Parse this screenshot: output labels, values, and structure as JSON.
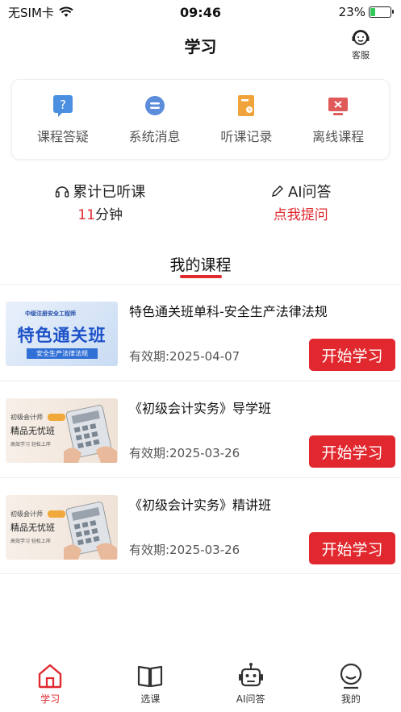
{
  "status_bar": {
    "carrier": "无SIM卡",
    "time": "09:46",
    "battery": "23%",
    "battery_level": 0.23
  },
  "header": {
    "title": "学习",
    "service_label": "客服"
  },
  "quick_actions": [
    {
      "label": "课程答疑",
      "icon": "question-icon",
      "color": "#4a8fe0"
    },
    {
      "label": "系统消息",
      "icon": "message-icon",
      "color": "#5b8ddb"
    },
    {
      "label": "听课记录",
      "icon": "record-icon",
      "color": "#f0a33a"
    },
    {
      "label": "离线课程",
      "icon": "offline-icon",
      "color": "#e05a5a"
    }
  ],
  "stats": {
    "listen_title": "累计已听课",
    "listen_value": "11",
    "listen_unit": "分钟",
    "ai_title": "AI问答",
    "ai_action": "点我提问"
  },
  "section_title": "我的课程",
  "courses": [
    {
      "name": "特色通关班单科-安全生产法律法规",
      "expiry": "有效期:2025-04-07",
      "button": "开始学习",
      "thumb": {
        "top": "中级注册安全工程师",
        "main": "特色通关班",
        "sub": "安全生产法律法规"
      }
    },
    {
      "name": "《初级会计实务》导学班",
      "expiry": "有效期:2025-03-26",
      "button": "开始学习",
      "thumb": {
        "a": "初级会计师",
        "b": "精品无忧班",
        "c": "高效学习 轻松上岸"
      }
    },
    {
      "name": "《初级会计实务》精讲班",
      "expiry": "有效期:2025-03-26",
      "button": "开始学习",
      "thumb": {
        "a": "初级会计师",
        "b": "精品无忧班",
        "c": "高效学习 轻松上岸"
      }
    }
  ],
  "tabs": [
    {
      "label": "学习",
      "active": true
    },
    {
      "label": "选课",
      "active": false
    },
    {
      "label": "AI问答",
      "active": false
    },
    {
      "label": "我的",
      "active": false
    }
  ],
  "colors": {
    "accent": "#e0282e"
  }
}
